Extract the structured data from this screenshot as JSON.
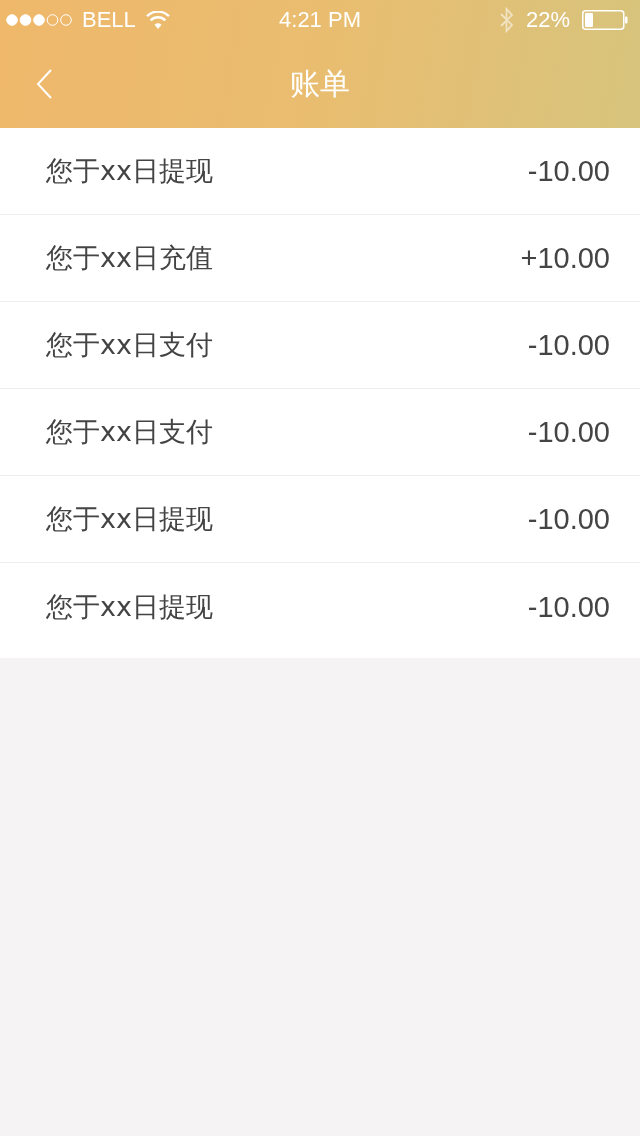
{
  "status_bar": {
    "carrier": "BELL",
    "time": "4:21 PM",
    "battery": "22%"
  },
  "nav_bar": {
    "title": "账单"
  },
  "bills": [
    {
      "description": "您于xx日提现",
      "amount": "-10.00"
    },
    {
      "description": "您于xx日充值",
      "amount": "+10.00"
    },
    {
      "description": "您于xx日支付",
      "amount": "-10.00"
    },
    {
      "description": "您于xx日支付",
      "amount": "-10.00"
    },
    {
      "description": "您于xx日提现",
      "amount": "-10.00"
    },
    {
      "description": "您于xx日提现",
      "amount": "-10.00"
    }
  ]
}
